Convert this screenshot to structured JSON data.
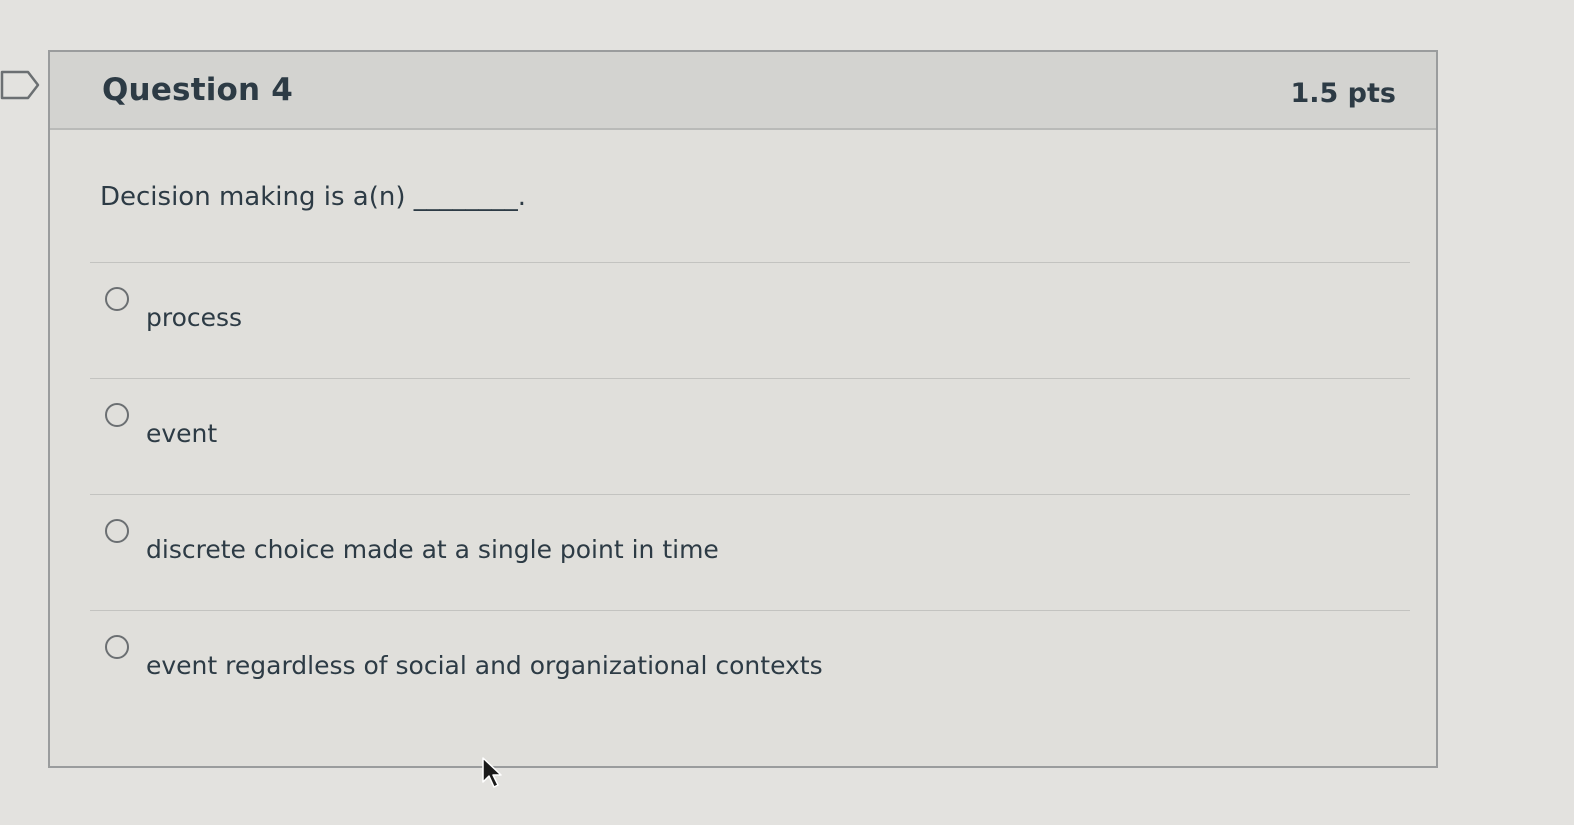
{
  "question": {
    "title": "Question 4",
    "points": "1.5 pts",
    "text": "Decision making is a(n) ________.",
    "answers": [
      {
        "label": "process",
        "selected": false
      },
      {
        "label": "event",
        "selected": false
      },
      {
        "label": "discrete choice made at a single point in time",
        "selected": false
      },
      {
        "label": "event regardless of social and organizational contexts",
        "selected": false
      }
    ]
  },
  "icons": {
    "bookmark": "bookmark-flag-icon",
    "cursor": "mouse-pointer-icon"
  }
}
